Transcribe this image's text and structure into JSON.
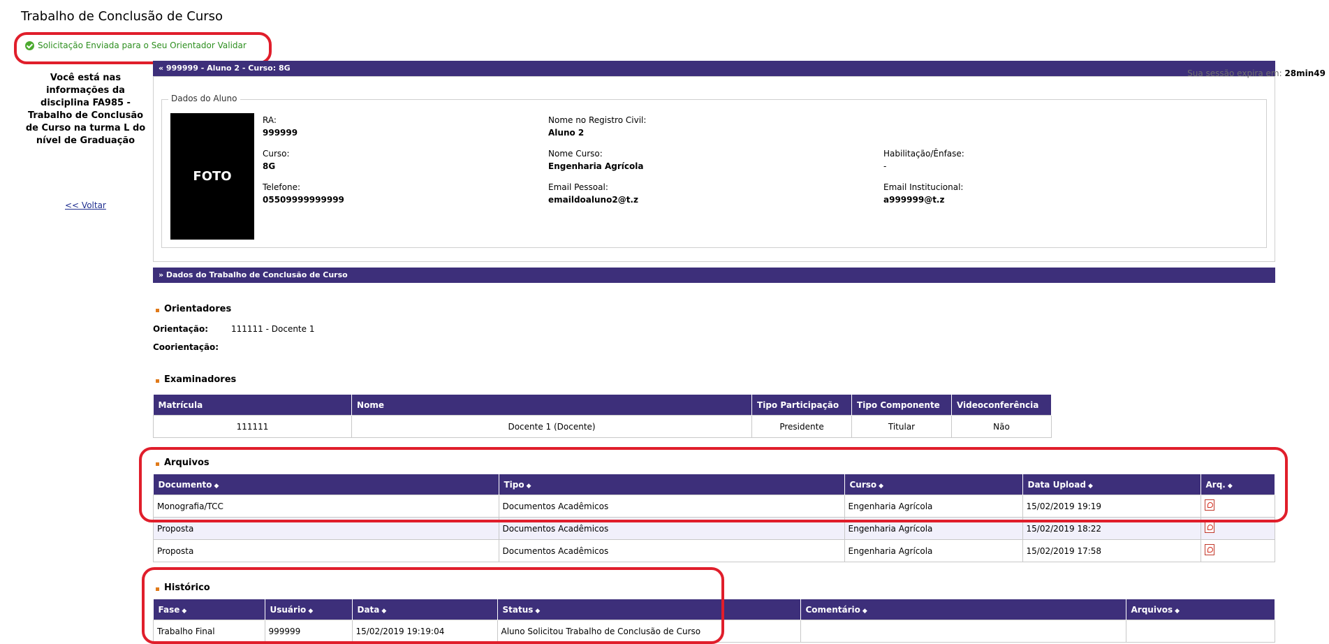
{
  "page": {
    "title": "Trabalho de Conclusão de Curso",
    "success_message": "Solicitação Enviada para o Seu Orientador Validar"
  },
  "sidebar": {
    "info": "Você está nas informações da disciplina FA985 - Trabalho de Conclusão de Curso na turma L do nível de Graduação",
    "back_link": "<< Voltar"
  },
  "student_bar": {
    "label": "«  999999 - Aluno 2 - Curso: 8G"
  },
  "session": {
    "prefix": "Sua sessão expira em: ",
    "time": "28min49"
  },
  "student": {
    "legend": "Dados do Aluno",
    "photo_label": "FOTO",
    "ra_label": "RA:",
    "ra": "999999",
    "nome_label": "Nome no Registro Civil:",
    "nome": "Aluno 2",
    "curso_label": "Curso:",
    "curso": "8G",
    "nome_curso_label": "Nome Curso:",
    "nome_curso": "Engenharia Agrícola",
    "habilitacao_label": "Habilitação/Ênfase:",
    "habilitacao": "-",
    "telefone_label": "Telefone:",
    "telefone": "05509999999999",
    "email_pessoal_label": "Email Pessoal:",
    "email_pessoal": "emaildoaluno2@t.z",
    "email_inst_label": "Email Institucional:",
    "email_inst": "a999999@t.z"
  },
  "tcc_bar": {
    "label": "»  Dados do Trabalho de Conclusão de Curso"
  },
  "orientadores": {
    "title": "Orientadores",
    "orientacao_label": "Orientação:",
    "orientacao": "111111 - Docente 1",
    "coorientacao_label": "Coorientação:"
  },
  "examinadores": {
    "title": "Examinadores",
    "headers": [
      "Matrícula",
      "Nome",
      "Tipo Participação",
      "Tipo Componente",
      "Videoconferência"
    ],
    "rows": [
      [
        "111111",
        "Docente 1 (Docente)",
        "Presidente",
        "Titular",
        "Não"
      ]
    ]
  },
  "arquivos": {
    "title": "Arquivos",
    "headers": [
      "Documento",
      "Tipo",
      "Curso",
      "Data Upload",
      "Arq."
    ],
    "rows": [
      [
        "Monografia/TCC",
        "Documentos Acadêmicos",
        "Engenharia Agrícola",
        "15/02/2019 19:19"
      ],
      [
        "Proposta",
        "Documentos Acadêmicos",
        "Engenharia Agrícola",
        "15/02/2019 18:22"
      ],
      [
        "Proposta",
        "Documentos Acadêmicos",
        "Engenharia Agrícola",
        "15/02/2019 17:58"
      ]
    ]
  },
  "historico": {
    "title": "Histórico",
    "headers": [
      "Fase",
      "Usuário",
      "Data",
      "Status",
      "Comentário",
      "Arquivos"
    ],
    "rows": [
      [
        "Trabalho Final",
        "999999",
        "15/02/2019 19:19:04",
        "Aluno Solicitou Trabalho de Conclusão de Curso",
        "",
        ""
      ]
    ]
  },
  "colors": {
    "header_purple": "#3d2f7a",
    "annotation_red": "#e01e2b",
    "success_green": "#2d8f1f",
    "bullet_orange": "#e07a1a"
  },
  "icons": {
    "success": "check-circle-icon",
    "file": "pdf-icon"
  }
}
